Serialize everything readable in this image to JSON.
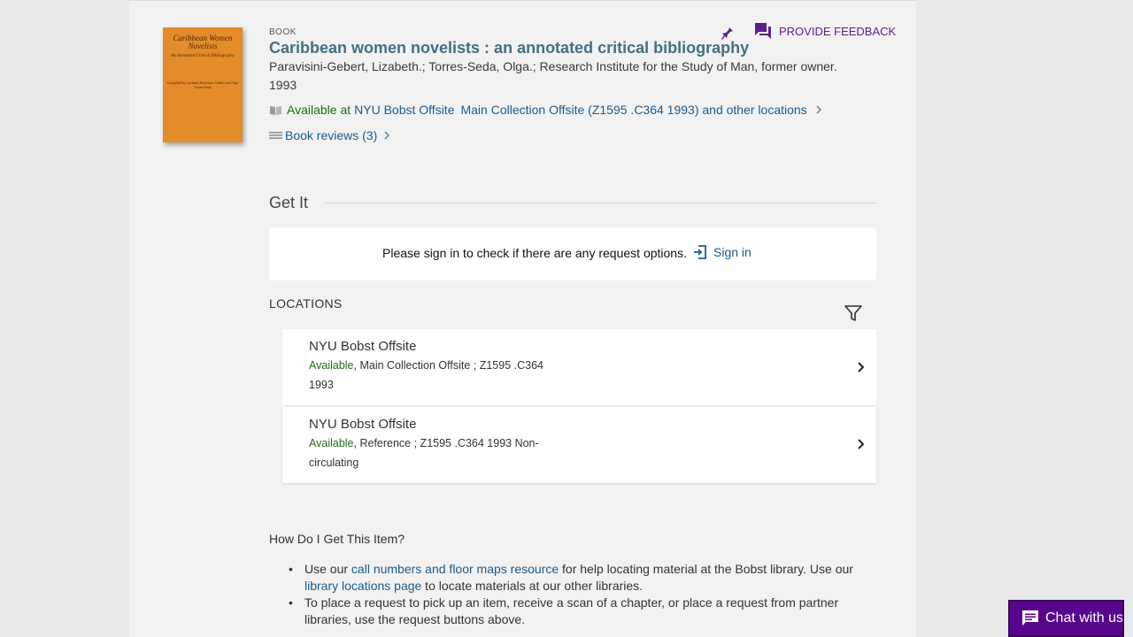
{
  "record": {
    "type_label": "BOOK",
    "title": "Caribbean women novelists : an annotated critical bibliography",
    "authors": "Paravisini-Gebert, Lizabeth.; Torres-Seda, Olga.; Research Institute for the Study of Man, former owner.",
    "date": "1993",
    "cover": {
      "title": "Caribbean Women Novelists",
      "subtitle": "An Annotated Critical Bibliography",
      "authors": "Compiled by Lizabeth Paravisini-Gebert and Olga Torres-Seda"
    }
  },
  "availability": {
    "status": "Available at",
    "library": "NYU Bobst Offsite",
    "location": "Main Collection Offsite (Z1595 .C364 1993) and other locations"
  },
  "reviews": {
    "label": "Book reviews (3)"
  },
  "actions": {
    "feedback_label": "PROVIDE FEEDBACK"
  },
  "getit": {
    "heading": "Get It",
    "signin_prompt": "Please sign in to check if there are any request options.",
    "signin_label": "Sign in"
  },
  "locations": {
    "heading": "LOCATIONS",
    "items": [
      {
        "library": "NYU Bobst Offsite",
        "status": "Available",
        "detail": ", Main Collection Offsite ; Z1595 .C364 1993"
      },
      {
        "library": "NYU Bobst Offsite",
        "status": "Available",
        "detail": ", Reference ; Z1595 .C364 1993 Non-circulating"
      }
    ]
  },
  "howto": {
    "heading": "How Do I Get This Item?",
    "b1_pre": "Use our ",
    "b1_link1": "call numbers and floor maps resource",
    "b1_mid": " for help locating material at the Bobst library. Use our ",
    "b1_link2": "library locations page",
    "b1_post": " to locate materials at our other libraries.",
    "b2": "To place a request to pick up an item, receive a scan of a chapter, or place a request from partner libraries, use the request buttons above."
  },
  "chat": {
    "label": "Chat with us"
  },
  "colors": {
    "accent": "#5a1f8e",
    "link": "#1e5a8a",
    "available": "#1d6f13",
    "title": "#447082"
  }
}
